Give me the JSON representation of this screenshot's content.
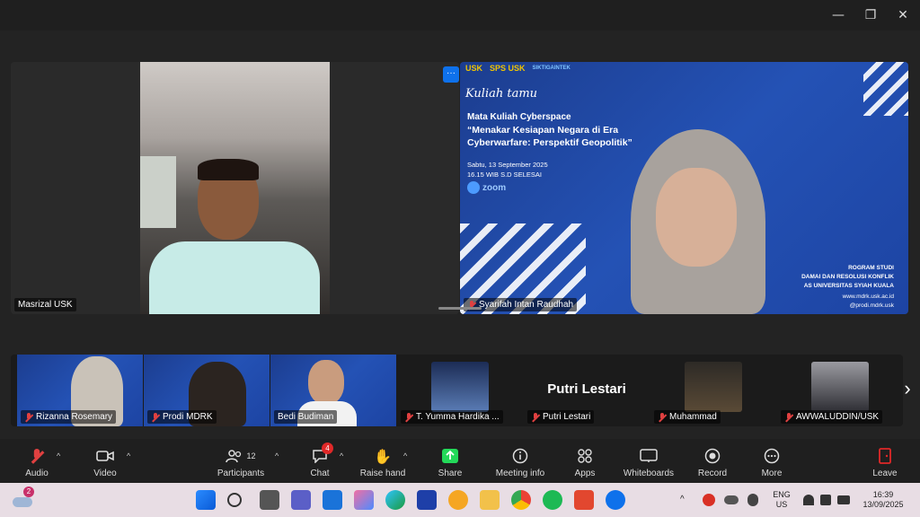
{
  "window": {
    "minimize": "—",
    "restore": "❐",
    "close": "✕"
  },
  "speakers": [
    {
      "name": "Masrizal USK"
    },
    {
      "name": "Syarifah Intan Raudhah"
    }
  ],
  "slide": {
    "logos": [
      "USK",
      "SPS USK",
      "SIKTIGAINTEK"
    ],
    "script_title": "Kuliah tamu",
    "course": "Mata Kuliah Cyberspace",
    "title_line1": "“Menakar Kesiapan Negara di Era",
    "title_line2": "Cyberwarfare: Perspektif Geopolitik”",
    "date": "Sabtu, 13 September 2025",
    "time": "16.15 WIB S.D SELESAI",
    "zoom": "zoom",
    "program_1": "ROGRAM STUDI",
    "program_2": "DAMAI DAN RESOLUSI KONFLIK",
    "program_3": "AS UNIVERSITAS SYIAH KUALA",
    "web": "www.mdrk.usk.ac.id",
    "ig": "@prodi.mdrk.usk"
  },
  "gallery": {
    "tiles": [
      {
        "name": "Rizanna Rosemary"
      },
      {
        "name": "Prodi MDRK"
      },
      {
        "name": "Bedi Budiman"
      },
      {
        "name": "T. Yumma Hardika ..."
      },
      {
        "name": "Putri Lestari",
        "big_name": "Putri Lestari"
      },
      {
        "name": "Muhammad"
      },
      {
        "name": "AWWALUDDIN/USK"
      }
    ],
    "next": "›"
  },
  "toolbar": {
    "audio": "Audio",
    "video": "Video",
    "participants": "Participants",
    "participants_count": "12",
    "chat": "Chat",
    "chat_badge": "4",
    "raise_hand": "Raise hand",
    "share": "Share",
    "meeting_info": "Meeting info",
    "apps": "Apps",
    "whiteboards": "Whiteboards",
    "record": "Record",
    "more": "More",
    "leave": "Leave"
  },
  "taskbar": {
    "weather_badge": "2",
    "lang_1": "ENG",
    "lang_2": "US",
    "time": "16:39",
    "date": "13/09/2025"
  },
  "colors": {
    "accent": "#0e71eb",
    "share_green": "#23d959",
    "leave_red": "#e02828",
    "slide_blue": "#2452b5"
  }
}
